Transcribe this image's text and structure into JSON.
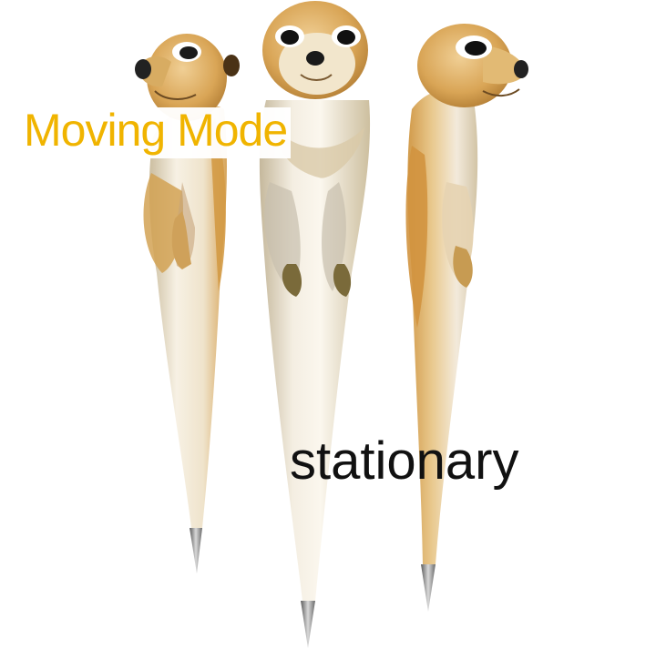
{
  "image": {
    "description_icons": [
      "meerkat-pen-icon",
      "meerkat-pen-icon",
      "meerkat-pen-icon"
    ]
  },
  "captions": {
    "moving": "Moving Mode",
    "stationary": "stationary"
  },
  "colors": {
    "fur": "#d7a55a",
    "fur_dark": "#b98032",
    "pearl": "#efe6d4",
    "pearl_shadow": "#c9bca2",
    "tip": "#8c8c8c",
    "caption_moving": "#f0b400",
    "caption_stationary": "#111111"
  }
}
